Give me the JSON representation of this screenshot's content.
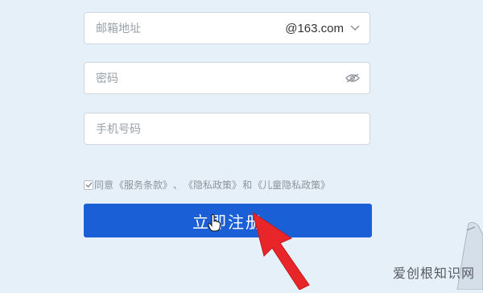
{
  "form": {
    "email": {
      "placeholder": "邮箱地址",
      "domain": "@163.com"
    },
    "password": {
      "placeholder": "密码"
    },
    "phone": {
      "placeholder": "手机号码"
    },
    "agreement": {
      "checked": true,
      "prefix": "同意",
      "terms_link": "《服务条款》",
      "separator": "、",
      "privacy_link": "《隐私政策》",
      "conjunction": "和",
      "child_privacy_link": "《儿童隐私政策》"
    },
    "submit_label": "立即注册"
  },
  "watermark": "爱创根知识网",
  "colors": {
    "background": "#e6f0f8",
    "button": "#1a5fd6",
    "arrow": "#e8262a"
  }
}
